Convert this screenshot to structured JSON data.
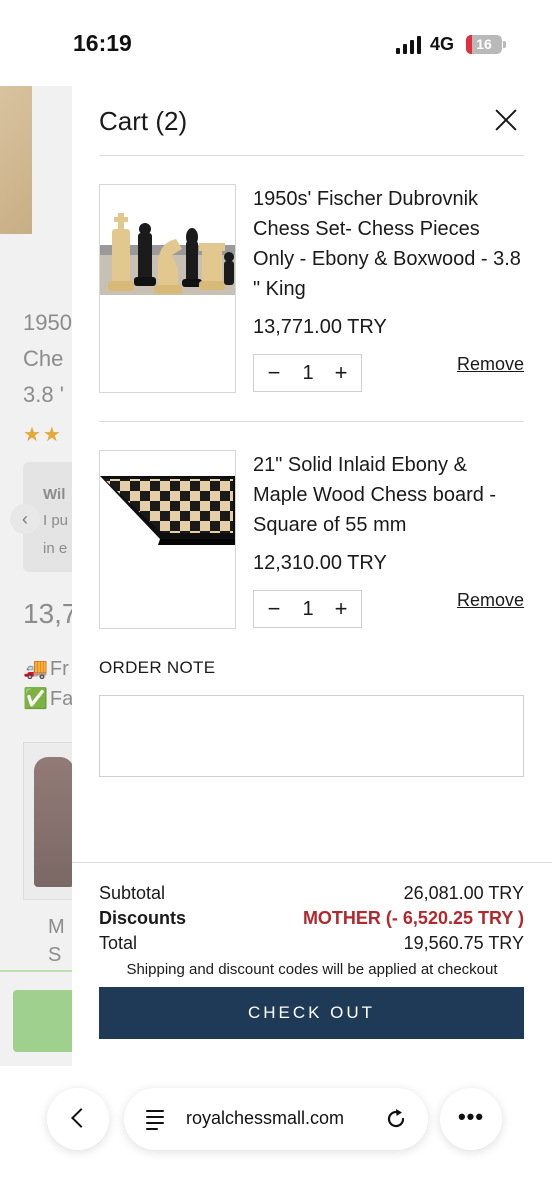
{
  "status_bar": {
    "time": "16:19",
    "network": "4G",
    "battery": "16",
    "battery_level": 0.16
  },
  "background_page": {
    "title_lines": [
      "1950",
      "Che",
      "3.8 '"
    ],
    "stars": "★★",
    "review_author": "Wil",
    "review_lines": [
      "I pu",
      "in e"
    ],
    "price": "13,7",
    "feature_lines": [
      {
        "icon": "🚚",
        "text": "Fr"
      },
      {
        "icon": "✅",
        "text": "Fa"
      }
    ],
    "caption_lines": [
      "M",
      "S"
    ]
  },
  "cart": {
    "title": "Cart (2)",
    "items": [
      {
        "name": "1950s' Fischer Dubrovnik Chess Set- Chess Pieces Only - Ebony & Boxwood - 3.8 \" King",
        "price": "13,771.00 TRY",
        "quantity": "1",
        "remove_label": "Remove"
      },
      {
        "name": "21\" Solid Inlaid Ebony & Maple Wood Chess board - Square of 55 mm",
        "price": "12,310.00 TRY",
        "quantity": "1",
        "remove_label": "Remove"
      }
    ],
    "order_note_label": "ORDER NOTE",
    "order_note_value": "",
    "summary": {
      "subtotal_label": "Subtotal",
      "subtotal_value": "26,081.00 TRY",
      "discounts_label": "Discounts",
      "discounts_value": "MOTHER (- 6,520.25 TRY )",
      "total_label": "Total",
      "total_value": "19,560.75 TRY"
    },
    "footer_note": "Shipping and discount codes will be applied at checkout",
    "checkout_label": "CHECK OUT"
  },
  "browser": {
    "url": "royalchessmall.com"
  },
  "colors": {
    "checkout_button": "#1f3a56",
    "discount_text": "#b3282d"
  }
}
